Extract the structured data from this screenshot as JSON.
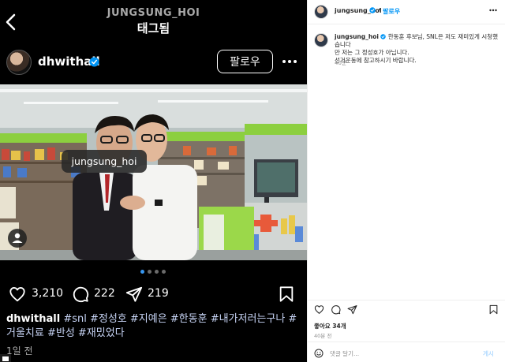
{
  "left": {
    "top_bar": {
      "username": "JUNGSUNG_HOI",
      "title": "태그됨"
    },
    "profile": {
      "name": "dhwithall",
      "follow_label": "팔로우"
    },
    "photo_tag": "jungsung_hoi",
    "carousel": {
      "count": 4,
      "active_index": 0
    },
    "actions": {
      "likes": "3,210",
      "comments": "222",
      "shares": "219"
    },
    "caption": {
      "username": "dhwithall",
      "hashtags": "#snl #정성호 #지예은 #한동훈 #내가저러는구나 #거울치료 #반성 #재밌었다"
    },
    "time": "1일 전"
  },
  "right": {
    "header": {
      "username": "jungsung_hoi",
      "separator": "•",
      "follow_label": "팔로우"
    },
    "comment": {
      "username": "jungsung_hoi",
      "lines": [
        "한동훈 후보님, SNL은 저도 재미있게 시청했습니다",
        "만 저는 그 정성호가 아닙니다.",
        "선거운동에 참고하시기 바랍니다."
      ],
      "time": "40분"
    },
    "likes": "좋아요 34개",
    "time": "40분 전",
    "input_placeholder": "댓글 달기...",
    "post_label": "게시"
  },
  "colors": {
    "verified": "#0095f6",
    "link": "#0095f6",
    "hashtag": "#c7d4f5",
    "muted": "#8e8e8e",
    "dark_bg": "#000000"
  },
  "icons": [
    "back-arrow-icon",
    "verified-icon",
    "more-icon",
    "heart-icon",
    "comment-icon",
    "share-icon",
    "bookmark-icon",
    "user-tag-icon",
    "emoji-icon"
  ]
}
